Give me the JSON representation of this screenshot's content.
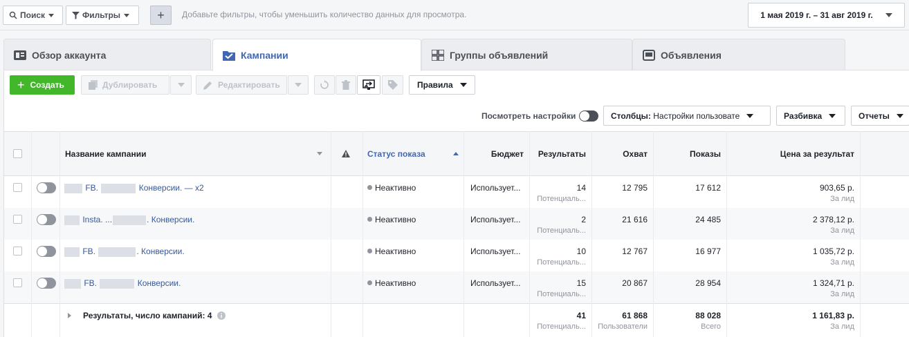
{
  "topbar": {
    "search_label": "Поиск",
    "filters_label": "Фильтры",
    "add_filter_symbol": "+",
    "hint": "Добавьте фильтры, чтобы уменьшить количество данных для просмотра.",
    "date_range": "1 мая 2019 г. – 31 авг 2019 г."
  },
  "tabs": [
    {
      "label": "Обзор аккаунта",
      "icon": "account-overview-icon"
    },
    {
      "label": "Кампании",
      "icon": "campaigns-icon"
    },
    {
      "label": "Группы объявлений",
      "icon": "ad-sets-icon"
    },
    {
      "label": "Объявления",
      "icon": "ads-icon"
    }
  ],
  "toolbar": {
    "create_label": "Создать",
    "duplicate_label": "Дублировать",
    "edit_label": "Редактировать",
    "rules_label": "Правила",
    "view_settings_label": "Посмотреть настройки",
    "columns_prefix": "Столбцы:",
    "columns_value": "Настройки пользовате",
    "breakdown_label": "Разбивка",
    "reports_label": "Отчеты"
  },
  "table": {
    "headers": {
      "name": "Название кампании",
      "delivery": "Статус показа",
      "budget": "Бюджет",
      "results": "Результаты",
      "reach": "Охват",
      "impressions": "Показы",
      "cost": "Цена за результат"
    },
    "rows": [
      {
        "name_mid": "FB.",
        "name_tail": "Конверсии. — х2",
        "status": "Неактивно",
        "budget": "Использует...",
        "results": "14",
        "results_sub": "Потенциаль...",
        "reach": "12 795",
        "impressions": "17 612",
        "cost": "903,65 р.",
        "cost_sub": "За лид"
      },
      {
        "name_mid": "Insta. ...",
        "name_tail": ". Конверсии.",
        "status": "Неактивно",
        "budget": "Использует...",
        "results": "2",
        "results_sub": "Потенциаль...",
        "reach": "21 616",
        "impressions": "24 485",
        "cost": "2 378,12 р.",
        "cost_sub": "За лид"
      },
      {
        "name_mid": "FB.",
        "name_tail": ". Конверсии.",
        "status": "Неактивно",
        "budget": "Использует...",
        "results": "10",
        "results_sub": "Потенциаль...",
        "reach": "12 767",
        "impressions": "16 977",
        "cost": "1 035,72 р.",
        "cost_sub": "За лид"
      },
      {
        "name_mid": "FB.",
        "name_tail": "Конверсии.",
        "status": "Неактивно",
        "budget": "Использует...",
        "results": "15",
        "results_sub": "Потенциаль...",
        "reach": "20 867",
        "impressions": "28 954",
        "cost": "1 324,71 р.",
        "cost_sub": "За лид"
      }
    ],
    "totals": {
      "label": "Результаты, число кампаний: 4",
      "results": "41",
      "results_sub": "Потенциаль...",
      "reach": "61 868",
      "reach_sub": "Пользователи",
      "impressions": "88 028",
      "impressions_sub": "Всего",
      "cost": "1 161,83 р.",
      "cost_sub": "За лид"
    }
  },
  "colors": {
    "accent": "#4267b2",
    "create_green": "#42b72a",
    "link": "#365899"
  }
}
